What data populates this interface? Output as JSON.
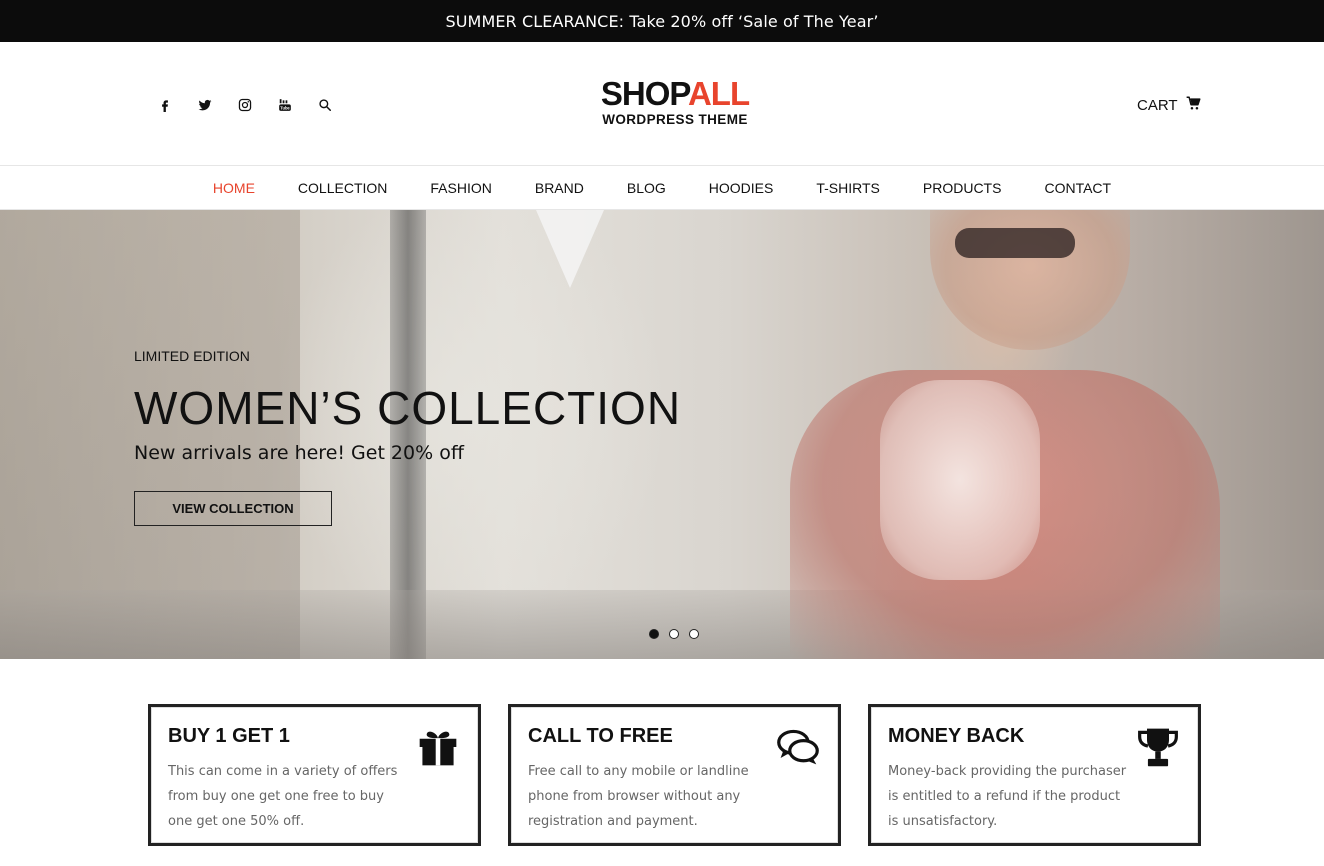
{
  "announcement": "SUMMER CLEARANCE: Take 20% off ‘Sale of The Year’",
  "header": {
    "socials": [
      {
        "name": "facebook-icon"
      },
      {
        "name": "twitter-icon"
      },
      {
        "name": "instagram-icon"
      },
      {
        "name": "youtube-icon"
      },
      {
        "name": "search-icon"
      }
    ],
    "logo": {
      "main_a": "SHOP",
      "main_b": "ALL",
      "sub": "WORDPRESS THEME"
    },
    "cart_label": "CART",
    "brand_color": "#e8442d"
  },
  "nav": {
    "items": [
      "HOME",
      "COLLECTION",
      "FASHION",
      "BRAND",
      "BLOG",
      "HOODIES",
      "T-SHIRTS",
      "PRODUCTS",
      "CONTACT"
    ],
    "active": "HOME"
  },
  "hero": {
    "eyebrow": "LIMITED EDITION",
    "title": "WOMEN’S COLLECTION",
    "subtitle": "New arrivals are here! Get 20% off",
    "button": "VIEW COLLECTION",
    "slides": 3,
    "active_slide": 1
  },
  "features": [
    {
      "title": "BUY 1 GET 1",
      "text": "This can come in a variety of offers from buy one get one free to buy one get one 50% off.",
      "icon": "gift-icon"
    },
    {
      "title": "CALL TO FREE",
      "text": "Free call to any mobile or landline phone from browser without any registration and payment.",
      "icon": "chat-bubbles-icon"
    },
    {
      "title": "MONEY BACK",
      "text": "Money-back providing the purchaser is entitled to a refund if the product is unsatisfactory.",
      "icon": "trophy-icon"
    }
  ]
}
